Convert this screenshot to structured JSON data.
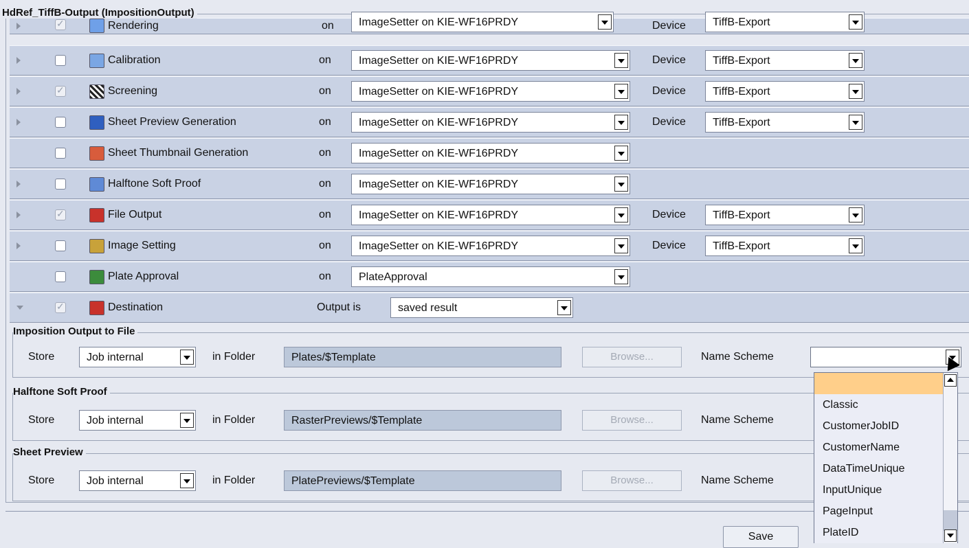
{
  "window": {
    "title": "HdRef_TiffB-Output (ImpositionOutput)"
  },
  "on_label": "on",
  "device_label": "Device",
  "rows": [
    {
      "name": "Rendering",
      "processor": "ImageSetter on KIE-WF16PRDY",
      "device": "TiffB-Export",
      "checked": true,
      "icon_color": "#6fa0e8"
    },
    {
      "name": "Calibration",
      "processor": "ImageSetter on KIE-WF16PRDY",
      "device": "TiffB-Export",
      "checked": false,
      "icon_color": "#7aa6e4"
    },
    {
      "name": "Screening",
      "processor": "ImageSetter on KIE-WF16PRDY",
      "device": "TiffB-Export",
      "checked": true,
      "icon_color": "#444444"
    },
    {
      "name": "Sheet Preview Generation",
      "processor": "ImageSetter on KIE-WF16PRDY",
      "device": "TiffB-Export",
      "checked": false,
      "icon_color": "#2f5fbf"
    },
    {
      "name": "Sheet Thumbnail Generation",
      "processor": "ImageSetter on KIE-WF16PRDY",
      "checked": false,
      "icon_color": "#d85c3c"
    },
    {
      "name": "Halftone Soft Proof",
      "processor": "ImageSetter on KIE-WF16PRDY",
      "checked": false,
      "icon_color": "#5f8ad6"
    },
    {
      "name": "File Output",
      "processor": "ImageSetter on KIE-WF16PRDY",
      "device": "TiffB-Export",
      "checked": true,
      "icon_color": "#c8322b"
    },
    {
      "name": "Image Setting",
      "processor": "ImageSetter on KIE-WF16PRDY",
      "device": "TiffB-Export",
      "checked": false,
      "icon_color": "#c8a23a"
    },
    {
      "name": "Plate Approval",
      "processor": "PlateApproval",
      "checked": false,
      "icon_color": "#3c8c3c"
    }
  ],
  "destination": {
    "name": "Destination",
    "output_label": "Output is",
    "output_value": "saved result",
    "checked": true
  },
  "sections": [
    {
      "title": "Imposition Output to File",
      "store_label": "Store",
      "store_value": "Job internal",
      "folder_label": "in Folder",
      "folder_value": "Plates/$Template",
      "browse_label": "Browse...",
      "scheme_label": "Name Scheme"
    },
    {
      "title": "Halftone Soft Proof",
      "store_label": "Store",
      "store_value": "Job internal",
      "folder_label": "in Folder",
      "folder_value": "RasterPreviews/$Template",
      "browse_label": "Browse...",
      "scheme_label": "Name Scheme"
    },
    {
      "title": "Sheet Preview",
      "store_label": "Store",
      "store_value": "Job internal",
      "folder_label": "in Folder",
      "folder_value": "PlatePreviews/$Template",
      "browse_label": "Browse...",
      "scheme_label": "Name Scheme"
    }
  ],
  "name_scheme_dropdown": {
    "current_value": "",
    "options": [
      "",
      "Classic",
      "CustomerJobID",
      "CustomerName",
      "DataTimeUnique",
      "InputUnique",
      "PageInput",
      "PlateID"
    ]
  },
  "footer": {
    "save_label": "Save"
  }
}
